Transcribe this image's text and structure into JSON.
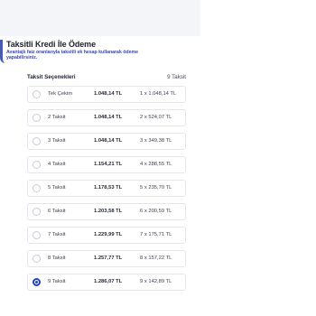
{
  "section": {
    "title": "Taksitli Kredi İle Ödeme",
    "description": "Avantajlı faiz oranlarıyla taksitli ek hesap kullanarak ödeme yapabilirsiniz."
  },
  "options": {
    "header": "Taksit Seçenekleri",
    "selected_count": "9 Taksit",
    "accent_color": "#1f43c9",
    "rows": [
      {
        "label": "Tek Çekim",
        "total": "1.048,14 TL",
        "per": "1 x 1.048,14 TL",
        "selected": false
      },
      {
        "label": "2 Taksit",
        "total": "1.048,14 TL",
        "per": "2 x 524,07 TL",
        "selected": false
      },
      {
        "label": "3 Taksit",
        "total": "1.048,14 TL",
        "per": "3 x 349,38 TL",
        "selected": false
      },
      {
        "label": "4 Taksit",
        "total": "1.154,21 TL",
        "per": "4 x 288,55 TL",
        "selected": false
      },
      {
        "label": "5 Taksit",
        "total": "1.178,53 TL",
        "per": "5 x 235,70 TL",
        "selected": false
      },
      {
        "label": "6 Taksit",
        "total": "1.203,58 TL",
        "per": "6 x 200,59 TL",
        "selected": false
      },
      {
        "label": "7 Taksit",
        "total": "1.229,99 TL",
        "per": "7 x 175,71 TL",
        "selected": false
      },
      {
        "label": "8 Taksit",
        "total": "1.257,77 TL",
        "per": "8 x 157,22 TL",
        "selected": false
      },
      {
        "label": "9 Taksit",
        "total": "1.286,07 TL",
        "per": "9 x 142,89 TL",
        "selected": true
      }
    ]
  }
}
